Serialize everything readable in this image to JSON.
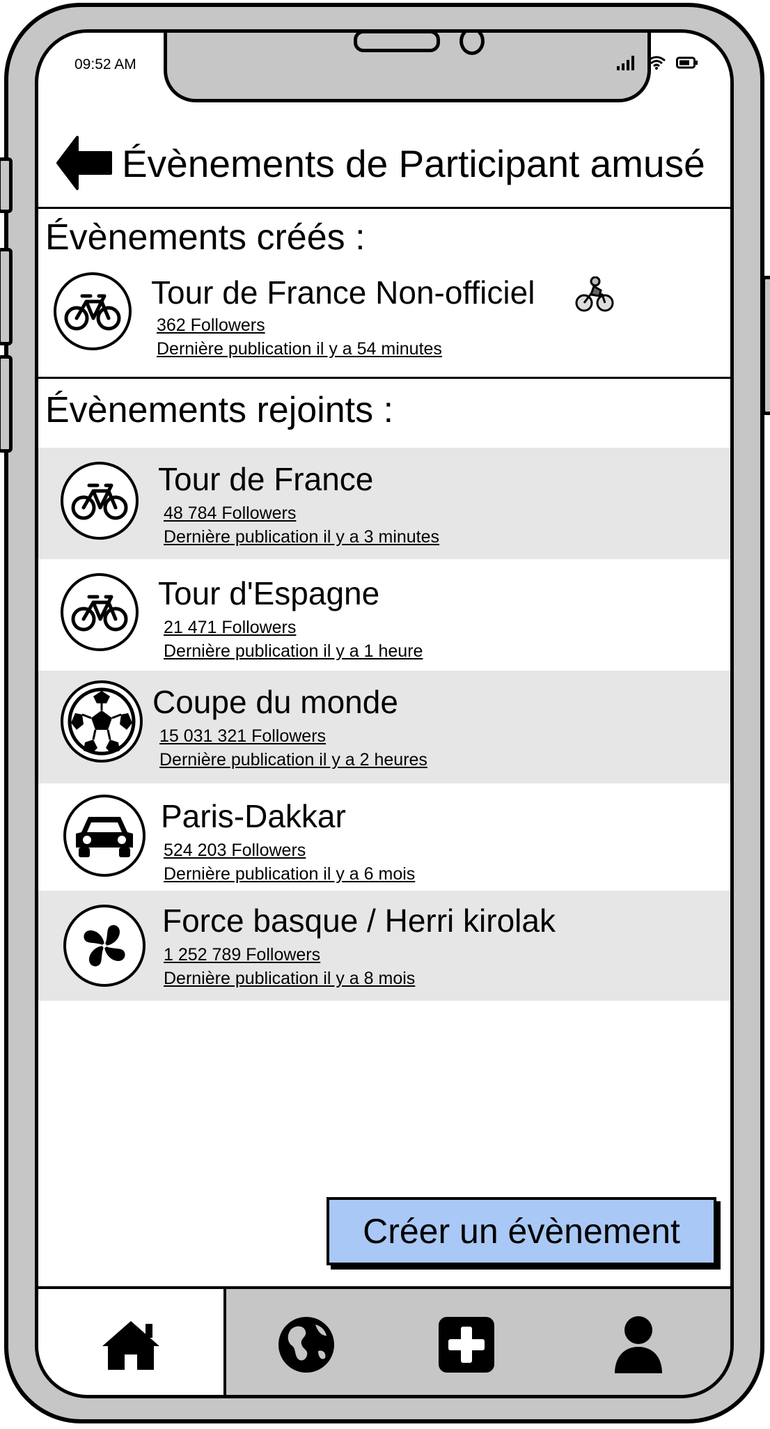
{
  "status_bar": {
    "time": "09:52 AM"
  },
  "header": {
    "title": "Évènements de Participant amusé"
  },
  "created_section": {
    "title": "Évènements créés :",
    "items": [
      {
        "name": "Tour de France Non-officiel",
        "followers": "362 Followers",
        "last_post": "Dernière publication il y a 54 minutes",
        "icon": "bicycle-icon",
        "badge_icon": "cyclist-emoji-icon"
      }
    ]
  },
  "joined_section": {
    "title": "Évènements rejoints :",
    "items": [
      {
        "name": "Tour de France",
        "followers": "48 784  Followers",
        "last_post": "Dernière publication il y a 3 minutes",
        "icon": "bicycle-icon"
      },
      {
        "name": "Tour d'Espagne",
        "followers": "21 471  Followers",
        "last_post": "Dernière publication il y a 1 heure",
        "icon": "bicycle-icon"
      },
      {
        "name": "Coupe du monde",
        "followers": "15 031 321  Followers",
        "last_post": "Dernière publication il y a 2 heures",
        "icon": "soccer-ball-icon"
      },
      {
        "name": "Paris-Dakkar",
        "followers": "524 203 Followers",
        "last_post": "Dernière publication il y a 6 mois",
        "icon": "car-icon"
      },
      {
        "name": "Force basque / Herri kirolak",
        "followers": "1 252 789 Followers",
        "last_post": "Dernière publication il y a 8 mois",
        "icon": "lauburu-icon"
      }
    ]
  },
  "create_button": {
    "label": "Créer un évènement"
  },
  "bottom_nav": {
    "items": [
      {
        "icon": "home-icon",
        "active": true
      },
      {
        "icon": "globe-icon",
        "active": false
      },
      {
        "icon": "plus-square-icon",
        "active": false
      },
      {
        "icon": "user-icon",
        "active": false
      }
    ]
  },
  "colors": {
    "accent_button": "#a9c8f5",
    "row_shade": "#e6e6e6",
    "frame": "#c6c6c6"
  }
}
